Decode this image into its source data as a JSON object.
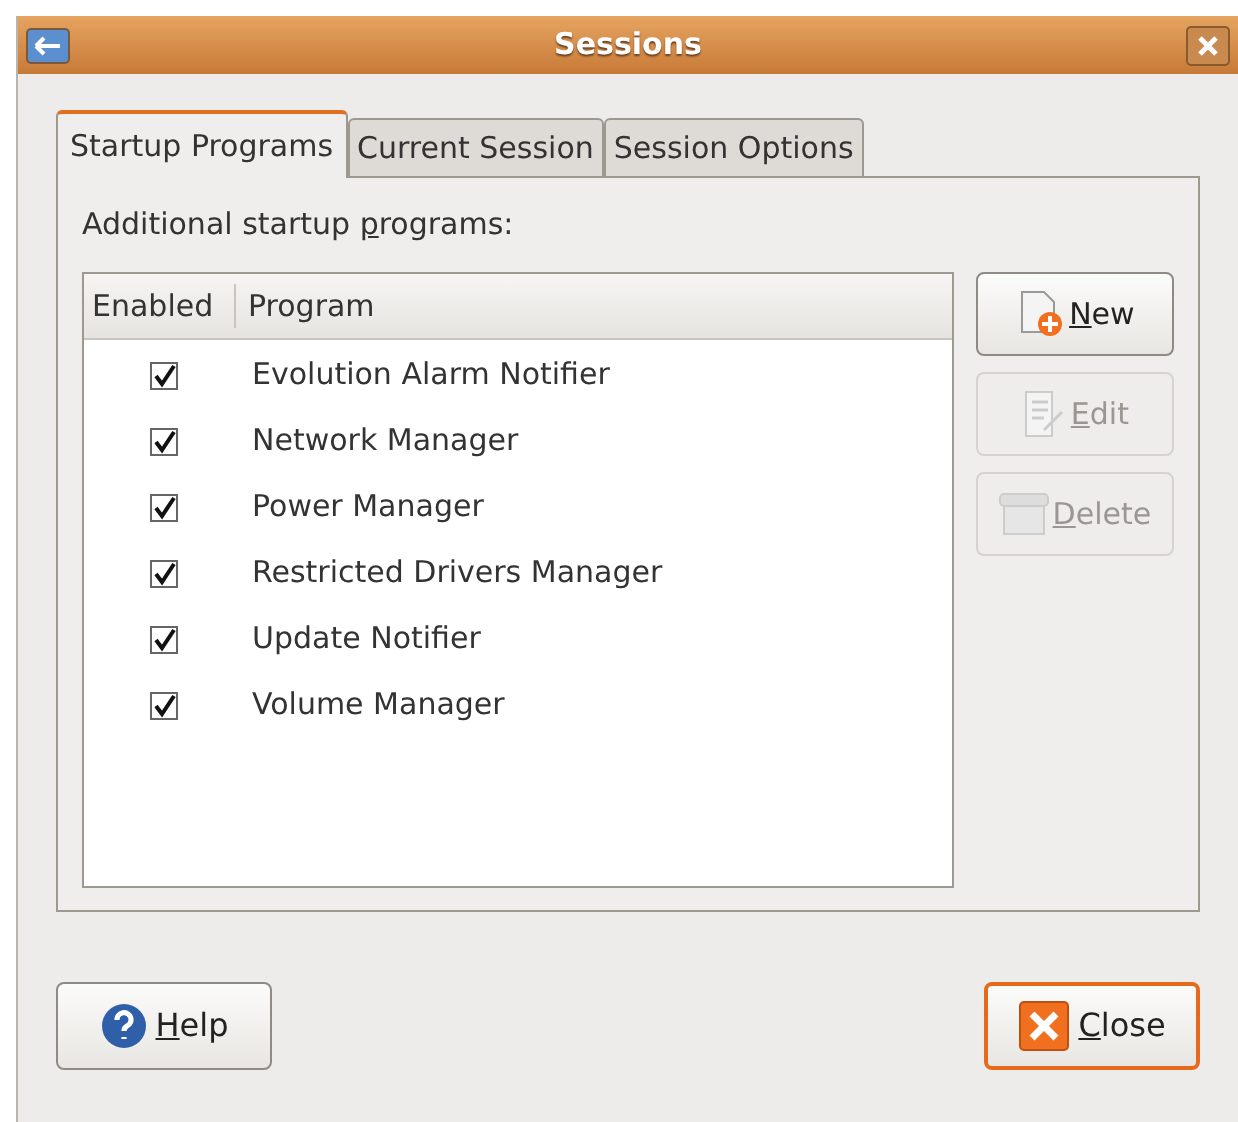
{
  "window": {
    "title": "Sessions"
  },
  "tabs": [
    {
      "label": "Startup Programs",
      "selected": true
    },
    {
      "label": "Current Session",
      "selected": false
    },
    {
      "label": "Session Options",
      "selected": false
    }
  ],
  "section_label": {
    "before": "Additional startup ",
    "key": "p",
    "after": "rograms:"
  },
  "table": {
    "columns": [
      "Enabled",
      "Program"
    ],
    "rows": [
      {
        "enabled": true,
        "program": "Evolution Alarm Notifier"
      },
      {
        "enabled": true,
        "program": "Network Manager"
      },
      {
        "enabled": true,
        "program": "Power Manager"
      },
      {
        "enabled": true,
        "program": "Restricted Drivers Manager"
      },
      {
        "enabled": true,
        "program": "Update Notifier"
      },
      {
        "enabled": true,
        "program": "Volume Manager"
      }
    ]
  },
  "side_buttons": [
    {
      "kind": "new",
      "key": "N",
      "after": "ew",
      "disabled": false
    },
    {
      "kind": "edit",
      "key": "E",
      "after": "dit",
      "disabled": true
    },
    {
      "kind": "delete",
      "key": "D",
      "after": "elete",
      "disabled": true
    }
  ],
  "bottom_buttons": [
    {
      "kind": "help",
      "key": "H",
      "after": "elp",
      "focused": false
    },
    {
      "kind": "close",
      "key": "C",
      "after": "lose",
      "focused": true
    }
  ]
}
